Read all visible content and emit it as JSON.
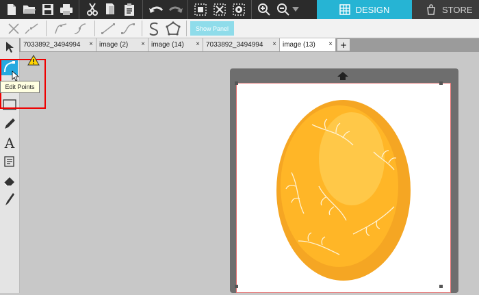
{
  "topbar": {
    "icons": [
      "new-file-icon",
      "open-folder-icon",
      "save-icon",
      "print-icon",
      "cut-icon",
      "copy-icon",
      "paste-icon",
      "undo-icon",
      "redo-icon",
      "group-icon",
      "ungroup-icon",
      "select-icon",
      "zoom-in-icon",
      "zoom-out-icon",
      "zoom-dropdown-icon"
    ],
    "design_tab": "DESIGN",
    "store_tab": "STORE"
  },
  "toolbar2": {
    "show_panel_label": "Show Panel"
  },
  "tabs": [
    {
      "label": "7033892_3494994",
      "active": false
    },
    {
      "label": "image (2)",
      "active": false
    },
    {
      "label": "image (14)",
      "active": false
    },
    {
      "label": "7033892_3494994",
      "active": false
    },
    {
      "label": "image (13)",
      "active": true
    }
  ],
  "tab_close_symbol": "×",
  "tab_add_symbol": "+",
  "tooltip": "Edit Points",
  "colors": {
    "accent": "#26b4d4",
    "highlight_border": "#ee0000",
    "egg_main": "#f7a823",
    "egg_light": "#ffc848"
  }
}
